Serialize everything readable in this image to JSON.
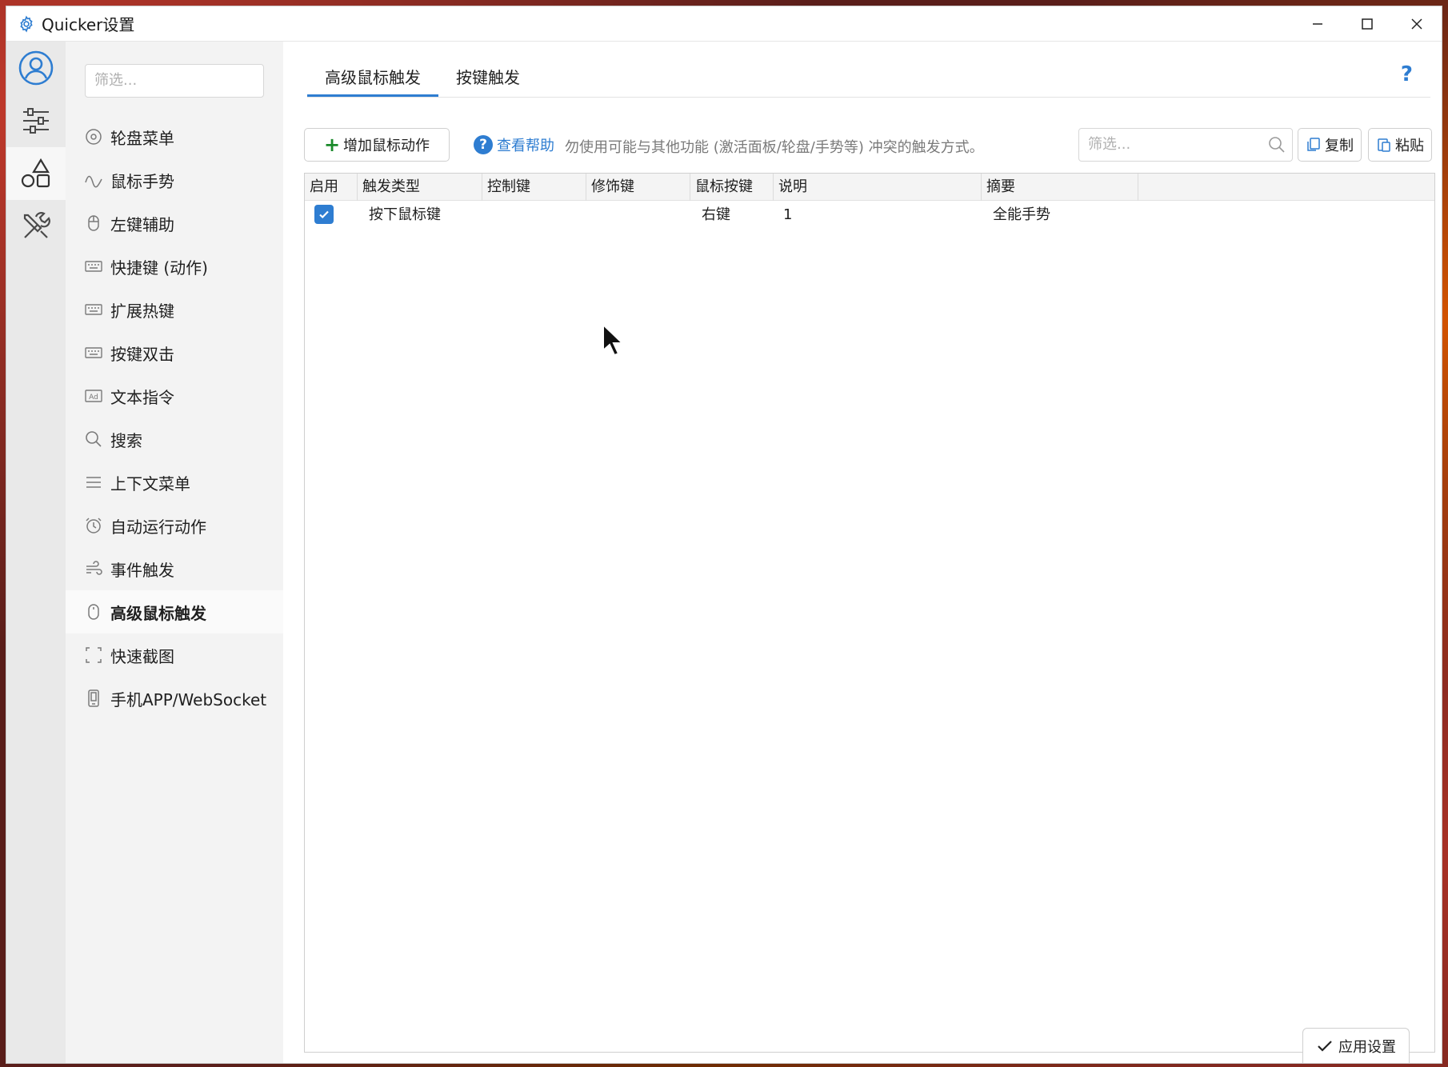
{
  "window": {
    "title": "Quicker设置"
  },
  "sidebar": {
    "filter_placeholder": "筛选...",
    "items": [
      {
        "label": "轮盘菜单",
        "icon": "wheel-icon"
      },
      {
        "label": "鼠标手势",
        "icon": "wave-icon"
      },
      {
        "label": "左键辅助",
        "icon": "mouse-icon"
      },
      {
        "label": "快捷键 (动作)",
        "icon": "keyboard-icon"
      },
      {
        "label": "扩展热键",
        "icon": "keyboard-icon"
      },
      {
        "label": "按键双击",
        "icon": "keyboard-icon"
      },
      {
        "label": "文本指令",
        "icon": "ad-icon"
      },
      {
        "label": "搜索",
        "icon": "search-icon"
      },
      {
        "label": "上下文菜单",
        "icon": "menu-icon"
      },
      {
        "label": "自动运行动作",
        "icon": "alarm-icon"
      },
      {
        "label": "事件触发",
        "icon": "wind-icon"
      },
      {
        "label": "高级鼠标触发",
        "icon": "mouse-icon",
        "active": true
      },
      {
        "label": "快速截图",
        "icon": "crop-icon"
      },
      {
        "label": "手机APP/WebSocket",
        "icon": "phone-icon"
      }
    ]
  },
  "tabs": [
    {
      "label": "高级鼠标触发",
      "active": true
    },
    {
      "label": "按键触发",
      "active": false
    }
  ],
  "help_icon": "?",
  "toolbar": {
    "add_label": "增加鼠标动作",
    "help_label": "查看帮助",
    "warning": "勿使用可能与其他功能 (激活面板/轮盘/手势等) 冲突的触发方式。",
    "filter_placeholder": "筛选...",
    "copy_label": "复制",
    "paste_label": "粘贴"
  },
  "table": {
    "columns": [
      "启用",
      "触发类型",
      "控制键",
      "修饰键",
      "鼠标按键",
      "说明",
      "摘要"
    ],
    "rows": [
      {
        "enabled": true,
        "type": "按下鼠标键",
        "ctrl": "",
        "modifier": "",
        "button": "右键",
        "desc": "1",
        "summary": "全能手势"
      }
    ]
  },
  "apply_label": "应用设置",
  "colors": {
    "accent": "#2e7dd1",
    "add_plus": "#1a8a2a"
  }
}
